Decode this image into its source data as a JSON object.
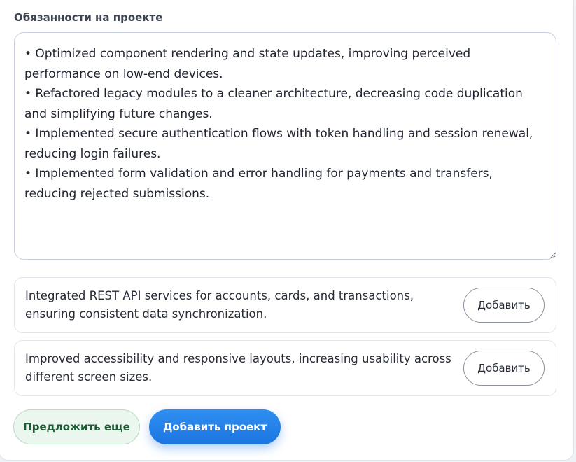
{
  "form": {
    "section_label": "Обязанности на проекте",
    "duties_value": "• Optimized component rendering and state updates, improving perceived performance on low-end devices.\n• Refactored legacy modules to a cleaner architecture, decreasing code duplication and simplifying future changes.\n• Implemented secure authentication flows with token handling and session renewal, reducing login failures.\n• Implemented form validation and error handling for payments and transfers, reducing rejected submissions."
  },
  "suggestions": [
    {
      "text": "Integrated REST API services for accounts, cards, and transactions, ensuring consistent data synchronization.",
      "button_label": "Добавить"
    },
    {
      "text": "Improved accessibility and responsive layouts, increasing usability across different screen sizes.",
      "button_label": "Добавить"
    }
  ],
  "actions": {
    "suggest_more_label": "Предложить еще",
    "add_project_label": "Добавить проект"
  },
  "colors": {
    "primary": "#1c75e0",
    "secondary_bg": "#eaf6ee",
    "secondary_text": "#1e5a34"
  }
}
